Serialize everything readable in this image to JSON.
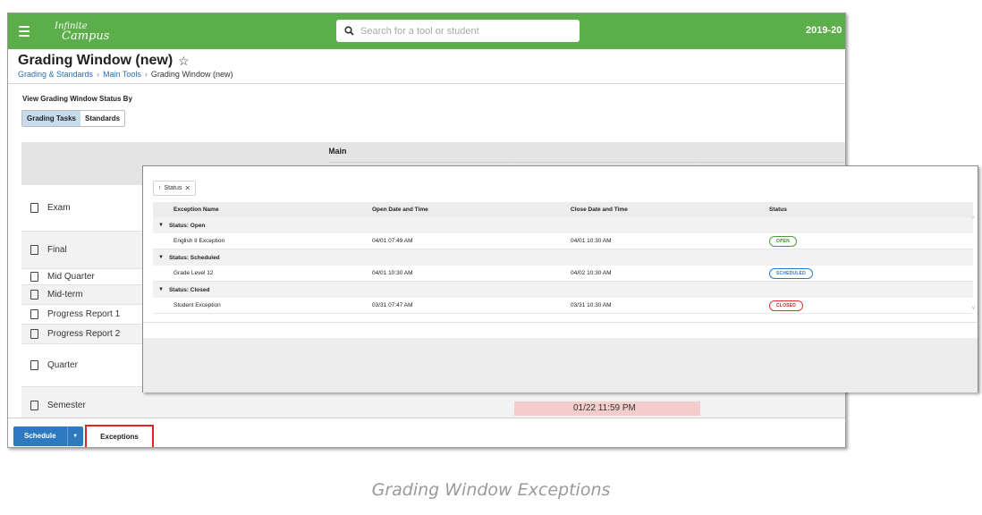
{
  "header": {
    "logo_line1": "Infinite",
    "logo_line2": "Campus",
    "search_placeholder": "Search for a tool or student",
    "year": "2019-20"
  },
  "page": {
    "title": "Grading Window (new)",
    "breadcrumb": [
      "Grading & Standards",
      "Main Tools",
      "Grading Window (new)"
    ]
  },
  "view": {
    "label": "View Grading Window Status By",
    "options": [
      "Grading Tasks",
      "Standards"
    ],
    "selected": "Grading Tasks"
  },
  "grid": {
    "group_header": "Main",
    "tasks": [
      "Exam",
      "Final",
      "Mid Quarter",
      "Mid-term",
      "Progress Report 1",
      "Progress Report 2",
      "Quarter",
      "Semester"
    ],
    "visible_cell": "01/22 11:59 PM"
  },
  "footer": {
    "schedule_label": "Schedule",
    "exceptions_label": "Exceptions"
  },
  "exceptions": {
    "sort_chip": "Status",
    "columns": [
      "Exception Name",
      "Open Date and Time",
      "Close Date and Time",
      "Status"
    ],
    "groups": [
      {
        "label": "Status: Open",
        "rows": [
          {
            "name": "English II Exception",
            "open": "04/01 07:49 AM",
            "close": "04/01 10:30 AM",
            "status": "OPEN"
          }
        ]
      },
      {
        "label": "Status: Scheduled",
        "rows": [
          {
            "name": "Grade Level 12",
            "open": "04/01 10:30 AM",
            "close": "04/02 10:30 AM",
            "status": "SCHEDULED"
          }
        ]
      },
      {
        "label": "Status: Closed",
        "rows": [
          {
            "name": "Student Exception",
            "open": "03/31 07:47 AM",
            "close": "03/31 10:30 AM",
            "status": "CLOSED"
          }
        ]
      }
    ]
  },
  "caption": "Grading Window Exceptions",
  "colors": {
    "topbar": "#5cae4a",
    "primary": "#2f79c0",
    "highlight": "#e02424"
  }
}
